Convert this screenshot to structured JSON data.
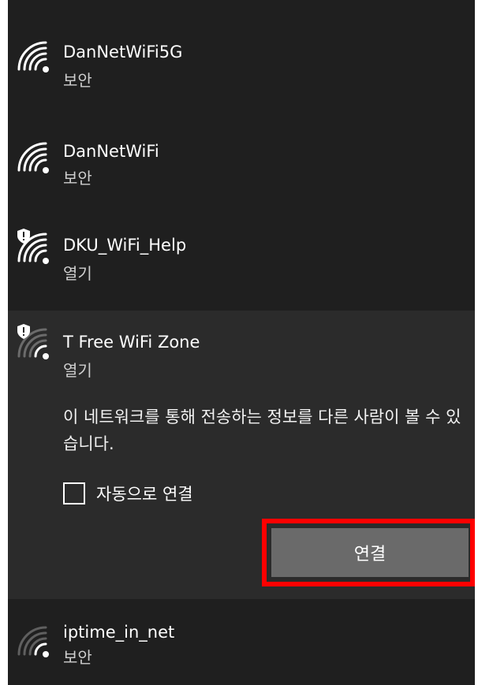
{
  "networks": [
    {
      "name": "DanNetWiFi5G",
      "status": "보안",
      "icon": "wifi-icon",
      "shield": false,
      "strength": "full"
    },
    {
      "name": "DanNetWiFi",
      "status": "보안",
      "icon": "wifi-icon",
      "shield": false,
      "strength": "full"
    },
    {
      "name": "DKU_WiFi_Help",
      "status": "열기",
      "icon": "wifi-open-icon",
      "shield": true,
      "strength": "full"
    },
    {
      "name": "T Free WiFi Zone",
      "status": "열기",
      "icon": "wifi-open-icon",
      "shield": true,
      "strength": "weak"
    },
    {
      "name": "iptime_in_net",
      "status": "보안",
      "icon": "wifi-icon",
      "shield": false,
      "strength": "weak"
    }
  ],
  "selected_network": {
    "description": "이 네트워크를 통해 전송하는 정보를 다른 사람이 볼 수 있습니다.",
    "auto_connect_label": "자동으로 연결",
    "auto_connect_checked": false,
    "connect_label": "연결"
  },
  "colors": {
    "panel_bg": "#1f1f1f",
    "selected_bg": "#2b2b2b",
    "button_bg": "#6a6a6a",
    "highlight": "#ff0000"
  }
}
